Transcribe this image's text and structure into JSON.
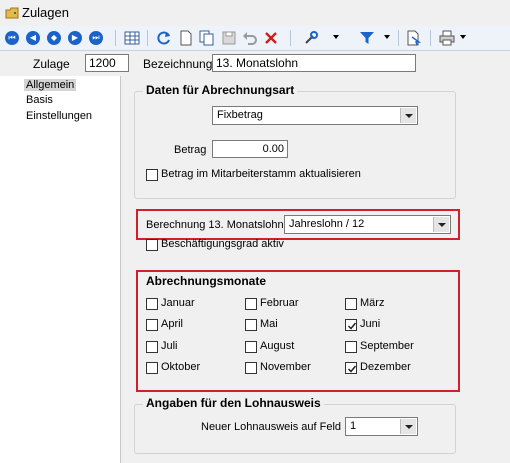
{
  "window": {
    "title": "Zulagen",
    "icon": "folder-plus-icon"
  },
  "toolbar": {
    "buttons": [
      "first-icon",
      "previous-icon",
      "binoculars-icon",
      "next-icon",
      "last-icon",
      "table-icon",
      "refresh-icon",
      "new-document-icon",
      "copy-icon",
      "save-icon",
      "undo-icon",
      "delete-icon",
      "tools-icon",
      "filter-icon",
      "export-icon",
      "print-icon"
    ]
  },
  "header": {
    "zulage_label": "Zulage",
    "zulage_value": "1200",
    "bezeichnung_label": "Bezeichnung",
    "bezeichnung_value": "13. Monatslohn"
  },
  "sidebar": {
    "items": [
      "Allgemein",
      "Basis",
      "Einstellungen"
    ],
    "selected": "Allgemein"
  },
  "abrechnungsart": {
    "title": "Daten für Abrechnungsart",
    "type_value": "Fixbetrag",
    "betrag_label": "Betrag",
    "betrag_value": "0.00",
    "update_label": "Betrag im Mitarbeiterstamm aktualisieren",
    "update_checked": false
  },
  "berechnung": {
    "label": "Berechnung 13. Monatslohn",
    "value": "Jahreslohn / 12",
    "beschaeftigung_label": "Beschäftigungsgrad aktiv",
    "beschaeftigung_checked": false
  },
  "months": {
    "title": "Abrechnungsmonate",
    "items": [
      {
        "label": "Januar",
        "checked": false
      },
      {
        "label": "Februar",
        "checked": false
      },
      {
        "label": "März",
        "checked": false
      },
      {
        "label": "April",
        "checked": false
      },
      {
        "label": "Mai",
        "checked": false
      },
      {
        "label": "Juni",
        "checked": true
      },
      {
        "label": "Juli",
        "checked": false
      },
      {
        "label": "August",
        "checked": false
      },
      {
        "label": "September",
        "checked": false
      },
      {
        "label": "Oktober",
        "checked": false
      },
      {
        "label": "November",
        "checked": false
      },
      {
        "label": "Dezember",
        "checked": true
      }
    ]
  },
  "lohnausweis": {
    "title": "Angaben für den Lohnausweis",
    "field_label": "Neuer Lohnausweis auf Feld",
    "field_value": "1"
  },
  "colors": {
    "highlight_border": "#d0202a",
    "nav_blue": "#1a63c8"
  }
}
